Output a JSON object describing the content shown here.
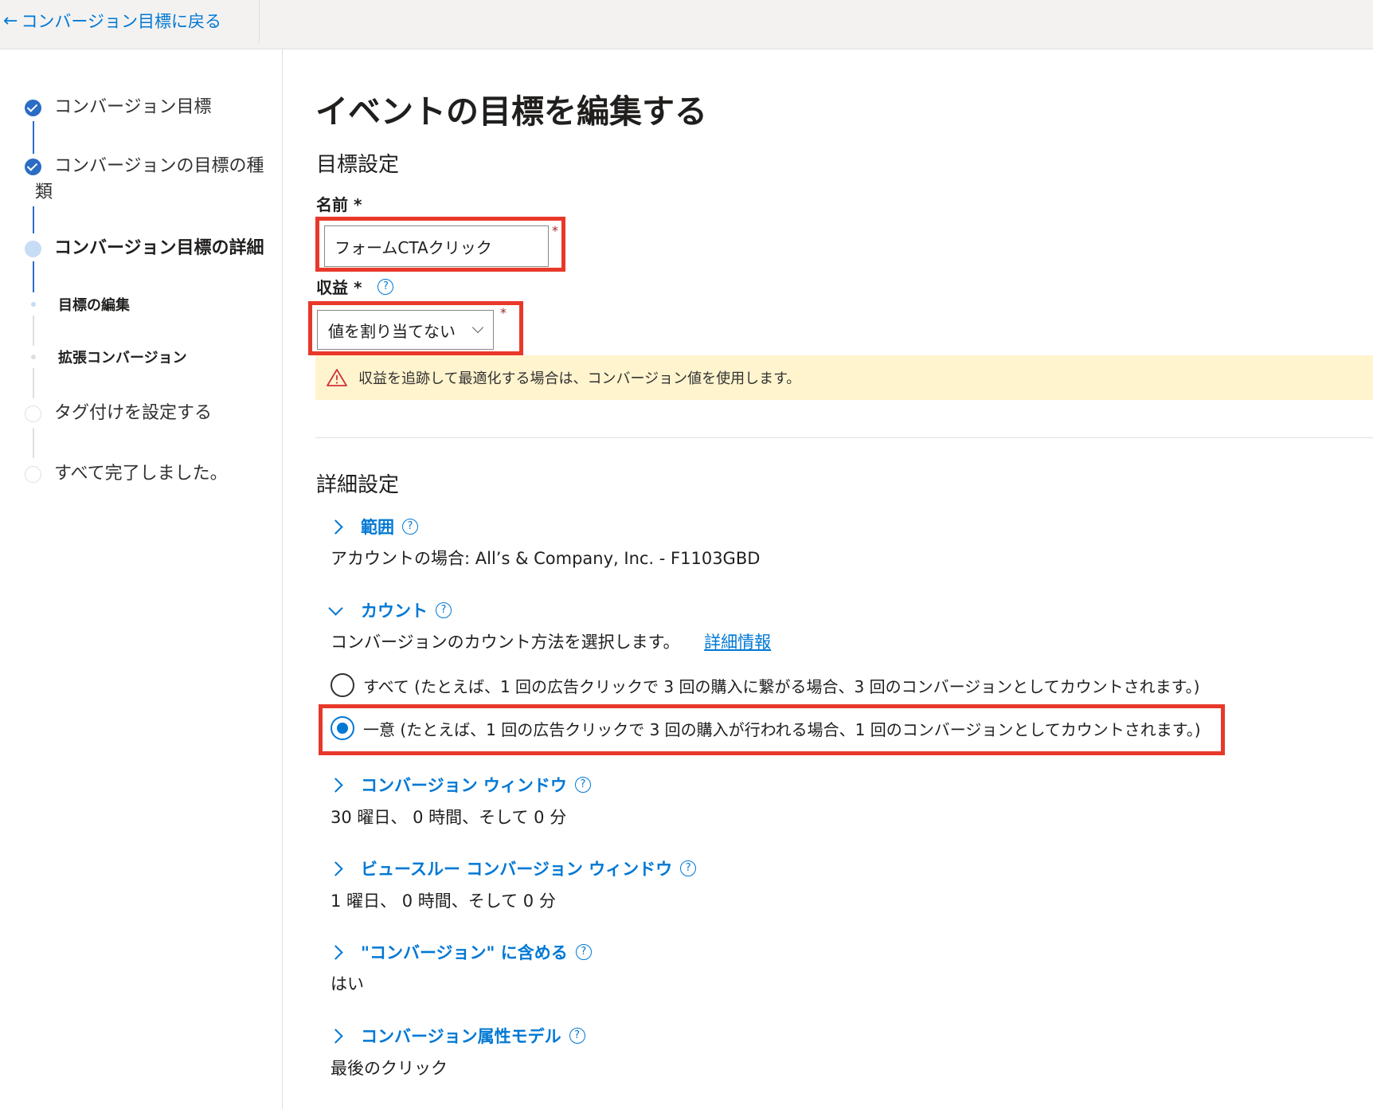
{
  "header": {
    "back_label": "コンバージョン目標に戻る"
  },
  "sidebar": {
    "steps": [
      {
        "label": "コンバージョン目標",
        "state": "done"
      },
      {
        "label": "コンバージョンの目標の種",
        "label_line2": "類",
        "state": "done"
      },
      {
        "label": "コンバージョン目標の詳細",
        "state": "current"
      },
      {
        "label": "目標の編集",
        "state": "substep-active"
      },
      {
        "label": "拡張コンバージョン",
        "state": "substep"
      },
      {
        "label": "タグ付けを設定する",
        "state": "todo"
      },
      {
        "label": "すべて完了しました。",
        "state": "todo"
      }
    ]
  },
  "main": {
    "page_title": "イベントの目標を編集する",
    "goal_settings": {
      "title": "目標設定",
      "name_label": "名前 *",
      "name_value": "フォームCTAクリック",
      "revenue_label": "収益 *",
      "revenue_value": "値を割り当てない",
      "required_mark": "*",
      "help": "?",
      "warning": "収益を追跡して最適化する場合は、コンバージョン値を使用します。"
    },
    "advanced": {
      "title": "詳細設定",
      "scope": {
        "label": "範囲",
        "value": "アカウントの場合: All’s & Company, Inc. - F1103GBD"
      },
      "count": {
        "label": "カウント",
        "description": "コンバージョンのカウント方法を選択します。",
        "link": "詳細情報",
        "options": [
          {
            "label": "すべて (たとえば、1 回の広告クリックで 3 回の購入に繋がる場合、3 回のコンバージョンとしてカウントされます。)",
            "checked": false
          },
          {
            "label": "一意 (たとえば、1 回の広告クリックで 3 回の購入が行われる場合、1 回のコンバージョンとしてカウントされます。)",
            "checked": true
          }
        ]
      },
      "conversion_window": {
        "label": "コンバージョン ウィンドウ",
        "value": "30 曜日、 0 時間、そして 0 分"
      },
      "view_through_window": {
        "label": "ビュースルー コンバージョン ウィンドウ",
        "value": "1 曜日、 0 時間、そして 0 分"
      },
      "include_in_conversions": {
        "label": "\"コンバージョン\" に含める",
        "value": "はい"
      },
      "attribution_model": {
        "label": "コンバージョン属性モデル",
        "value": "最後のクリック"
      }
    }
  },
  "colors": {
    "accent": "#0078d4",
    "highlight": "#e8382a",
    "warning_bg": "#fff4ce",
    "step_done": "#2b6cc4"
  }
}
